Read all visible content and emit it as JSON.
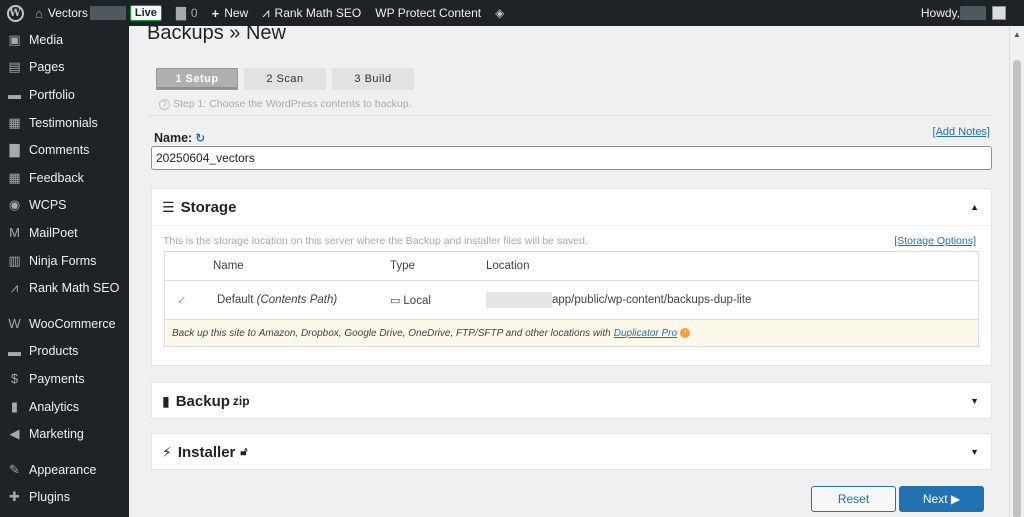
{
  "admin_bar": {
    "site_name": "Vectors",
    "live_badge": "Live",
    "comments_count": "0",
    "new_label": "New",
    "rank_math_label": "Rank Math SEO",
    "wp_protect_label": "WP Protect Content",
    "howdy_label": "Howdy,"
  },
  "sidebar": {
    "items": [
      {
        "label": "Media",
        "icon": "media-icon"
      },
      {
        "label": "Pages",
        "icon": "pages-icon"
      },
      {
        "label": "Portfolio",
        "icon": "portfolio-icon"
      },
      {
        "label": "Testimonials",
        "icon": "testimonials-icon"
      },
      {
        "label": "Comments",
        "icon": "comments-icon"
      },
      {
        "label": "Feedback",
        "icon": "feedback-icon"
      },
      {
        "label": "WCPS",
        "icon": "wcps-icon"
      },
      {
        "label": "MailPoet",
        "icon": "mailpoet-icon"
      },
      {
        "label": "Ninja Forms",
        "icon": "ninja-forms-icon"
      },
      {
        "label": "Rank Math SEO",
        "icon": "rank-math-icon"
      },
      {
        "label": "WooCommerce",
        "icon": "woocommerce-icon"
      },
      {
        "label": "Products",
        "icon": "products-icon"
      },
      {
        "label": "Payments",
        "icon": "payments-icon"
      },
      {
        "label": "Analytics",
        "icon": "analytics-icon"
      },
      {
        "label": "Marketing",
        "icon": "marketing-icon"
      },
      {
        "label": "Appearance",
        "icon": "appearance-icon"
      },
      {
        "label": "Plugins",
        "icon": "plugins-icon"
      }
    ]
  },
  "page": {
    "title": "Backups » New",
    "steps": [
      "1 Setup",
      "2 Scan",
      "3 Build"
    ],
    "step_note": "Step 1: Choose the WordPress contents to backup.",
    "name_label": "Name:",
    "add_notes": "[Add Notes]",
    "name_value": "20250604_vectors"
  },
  "storage": {
    "title": "Storage",
    "description": "This is the storage location on this server where the Backup and installer files will be saved.",
    "options_link": "[Storage Options]",
    "columns": [
      "Name",
      "Type",
      "Location"
    ],
    "row": {
      "check": "✓",
      "name": "Default",
      "name_note": "(Contents Path)",
      "type": "Local",
      "location": "app/public/wp-content/backups-dup-lite"
    },
    "promo_text": "Back up this site to",
    "promo_targets": "Amazon, Dropbox, Google Drive, OneDrive, FTP/SFTP and other locations with",
    "promo_link": "Duplicator Pro"
  },
  "backup_panel": {
    "title": "Backup",
    "suffix": "zip"
  },
  "installer_panel": {
    "title": "Installer"
  },
  "buttons": {
    "reset": "Reset",
    "next": "Next ▶"
  }
}
